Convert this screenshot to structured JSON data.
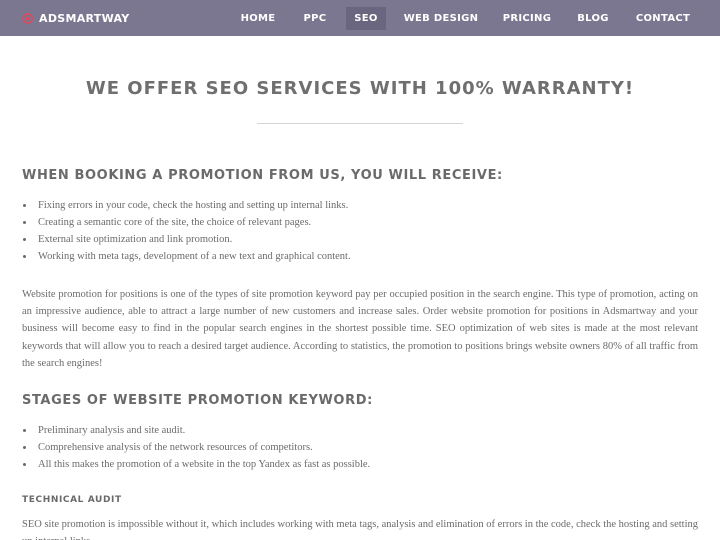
{
  "header": {
    "brand": "ADSMARTWAY",
    "brand_icon": "target-icon",
    "brand_icon_color": "#e0485a",
    "background_color": "#7b7791",
    "nav": [
      {
        "label": "HOME",
        "active": false
      },
      {
        "label": "PPC",
        "active": false
      },
      {
        "label": "SEO",
        "active": true
      },
      {
        "label": "WEB DESIGN",
        "active": false
      },
      {
        "label": "PRICING",
        "active": false
      },
      {
        "label": "BLOG",
        "active": false
      },
      {
        "label": "CONTACT",
        "active": false
      }
    ]
  },
  "main": {
    "title": "WE OFFER SEO SERVICES WITH 100% WARRANTY!",
    "sections": [
      {
        "heading": "WHEN BOOKING A PROMOTION FROM US, YOU WILL RECEIVE:",
        "items": [
          "Fixing errors in your code, check the hosting and setting up internal links.",
          "Creating a semantic core of the site, the choice of relevant pages.",
          "External site optimization and link promotion.",
          "Working with meta tags, development of a new text and graphical content."
        ],
        "paragraph": "Website promotion for positions is one of the types of site promotion keyword pay per occupied position in the search engine. This type of promotion, acting on an impressive audience, able to attract a large number of new customers and increase sales. Order website promotion for positions in Adsmartway and your business will become easy to find in the popular search engines in the shortest possible time. SEO optimization of web sites is made at the most relevant keywords that will allow you to reach a desired target audience. According to statistics, the promotion to positions brings website owners 80% of all traffic from the search engines!"
      },
      {
        "heading": "STAGES OF WEBSITE PROMOTION KEYWORD:",
        "items": [
          "Preliminary analysis and site audit.",
          "Comprehensive analysis of the network resources of competitors.",
          "All this makes the promotion of a website in the top Yandex as fast as possible."
        ]
      },
      {
        "heading": "TECHNICAL AUDIT",
        "paragraph": "SEO site promotion is impossible without it, which includes working with meta tags, analysis and elimination of errors in the code, check the hosting and setting up internal links."
      }
    ]
  }
}
